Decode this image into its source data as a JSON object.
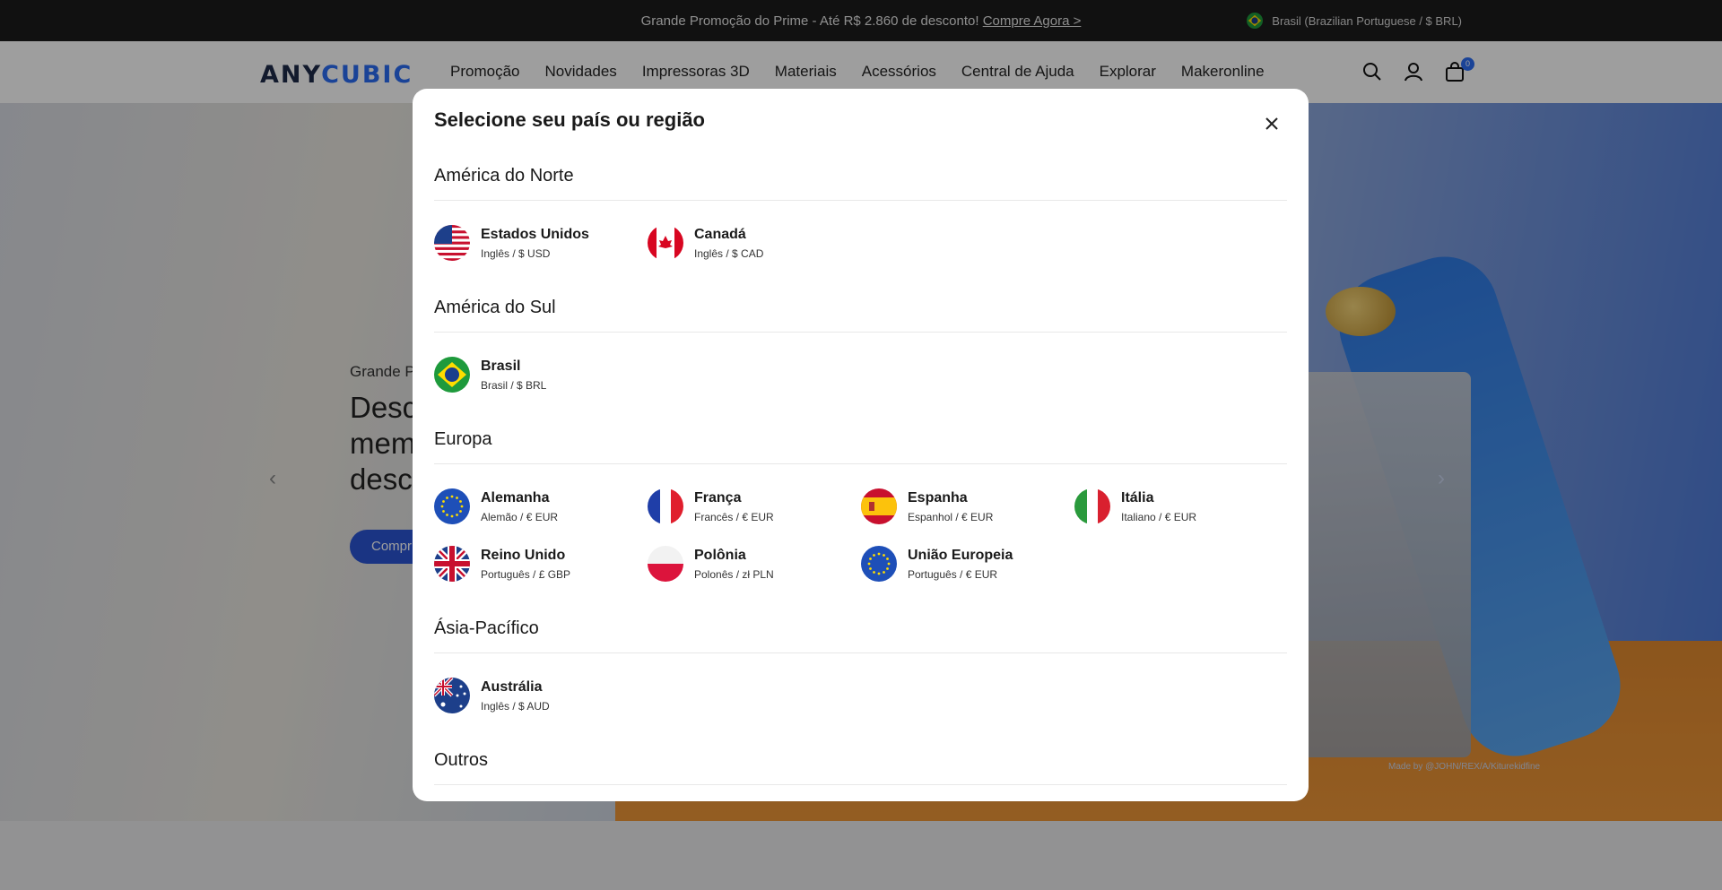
{
  "topbar": {
    "promo_text": "Grande Promoção do Prime - Até R$ 2.860 de desconto!",
    "promo_link": "Compre Agora >",
    "locale": "Brasil (Brazilian Portuguese / $ BRL)"
  },
  "header": {
    "logo_part1": "ANY",
    "logo_part2": "CUBIC",
    "nav": [
      "Promoção",
      "Novidades",
      "Impressoras 3D",
      "Materiais",
      "Acessórios",
      "Central de Ajuda",
      "Explorar",
      "Makeronline"
    ],
    "cart_count": "0",
    "icons": [
      "search-icon",
      "account-icon",
      "cart-icon"
    ]
  },
  "hero": {
    "subtitle": "Grande P",
    "headline_lines": [
      "Desc",
      "mem",
      "desco"
    ],
    "button_label": "Compr",
    "credit": "Made by @JOHN/REX/A/Kiturekidfine"
  },
  "modal": {
    "title": "Selecione seu país ou região",
    "sections": [
      {
        "title": "América do Norte",
        "countries": [
          {
            "name": "Estados Unidos",
            "info": "Inglês / $ USD",
            "flag": "us-flag-icon"
          },
          {
            "name": "Canadá",
            "info": "Inglês / $ CAD",
            "flag": "canada-flag-icon"
          }
        ]
      },
      {
        "title": "América do Sul",
        "countries": [
          {
            "name": "Brasil",
            "info": "Brasil / $ BRL",
            "flag": "brazil-flag-icon"
          }
        ]
      },
      {
        "title": "Europa",
        "countries": [
          {
            "name": "Alemanha",
            "info": "Alemão / € EUR",
            "flag": "eu-flag-icon"
          },
          {
            "name": "França",
            "info": "Francês / € EUR",
            "flag": "france-flag-icon"
          },
          {
            "name": "Espanha",
            "info": "Espanhol / € EUR",
            "flag": "spain-flag-icon"
          },
          {
            "name": "Itália",
            "info": "Italiano / € EUR",
            "flag": "italy-flag-icon"
          },
          {
            "name": "Reino Unido",
            "info": "Português / £ GBP",
            "flag": "uk-flag-icon"
          },
          {
            "name": "Polônia",
            "info": "Polonês / zł PLN",
            "flag": "poland-flag-icon"
          },
          {
            "name": "União Europeia",
            "info": "Português / € EUR",
            "flag": "eu-flag-icon"
          }
        ]
      },
      {
        "title": "Ásia-Pacífico",
        "countries": [
          {
            "name": "Austrália",
            "info": "Inglês / $ AUD",
            "flag": "australia-flag-icon"
          }
        ]
      },
      {
        "title": "Outros",
        "countries": []
      }
    ]
  },
  "colors": {
    "accent": "#2a6df4",
    "topbar_bg": "#1c1c1c",
    "overlay": "rgba(0,0,0,0.38)"
  }
}
